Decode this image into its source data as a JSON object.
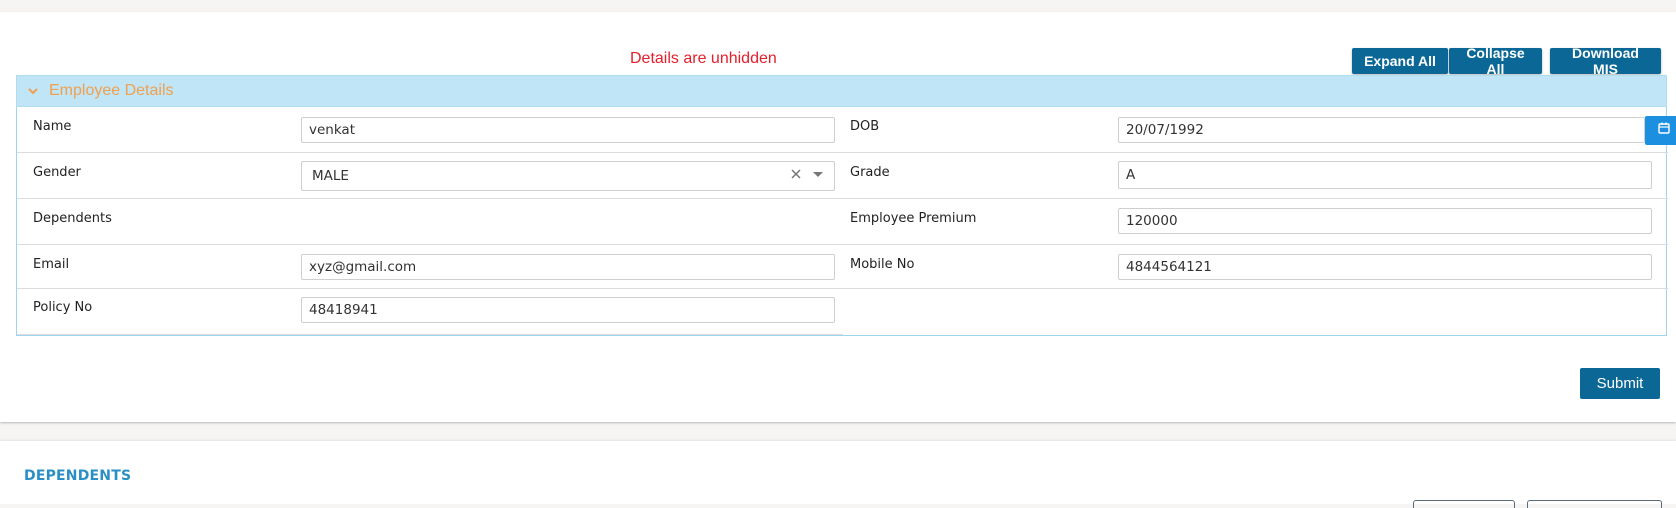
{
  "status_message": "Details are unhidden",
  "toolbar": {
    "expand_all": "Expand All",
    "collapse_all": "Collapse All",
    "download_mis": "Download MIS"
  },
  "panel": {
    "title": "Employee Details"
  },
  "fields": {
    "name": {
      "label": "Name",
      "value": "venkat"
    },
    "dob": {
      "label": "DOB",
      "value": "20/07/1992"
    },
    "gender": {
      "label": "Gender",
      "value": "MALE"
    },
    "grade": {
      "label": "Grade",
      "value": "A"
    },
    "dependents": {
      "label": "Dependents"
    },
    "employee_premium": {
      "label": "Employee Premium",
      "value": "120000"
    },
    "email": {
      "label": "Email",
      "value": "xyz@gmail.com"
    },
    "mobile_no": {
      "label": "Mobile No",
      "value": "4844564121"
    },
    "policy_no": {
      "label": "Policy No",
      "value": "48418941"
    }
  },
  "submit_label": "Submit",
  "dependents_section": {
    "title": "DEPENDENTS"
  },
  "icons": {
    "collapse": "chevron-down-icon",
    "calendar": "calendar-icon",
    "clear": "clear-icon",
    "dropdown": "caret-down-icon"
  },
  "colors": {
    "primary_button": "#0b6796",
    "status_message": "#e3202b",
    "panel_header_bg": "#bfe5f6",
    "panel_title": "#f0a050",
    "calendar_button": "#1d8fe0",
    "section_title": "#2a8fc4"
  }
}
